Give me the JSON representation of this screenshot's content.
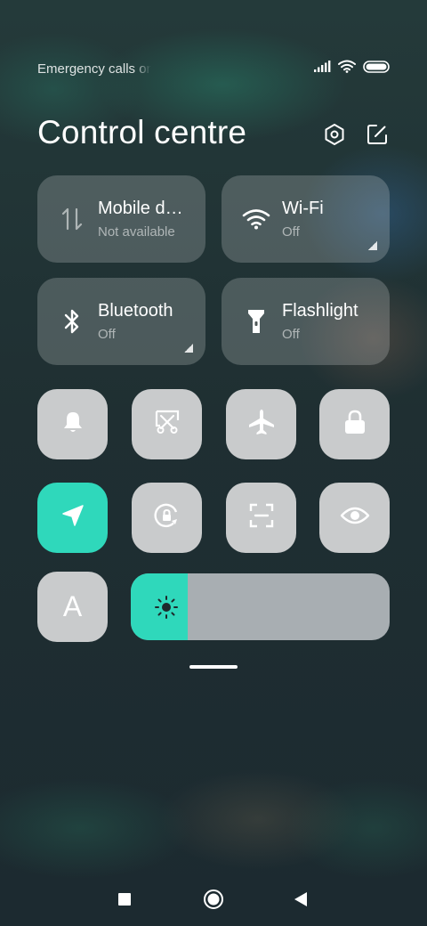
{
  "status_bar": {
    "text": "Emergency calls only",
    "icons": [
      "signal-icon",
      "wifi-icon",
      "battery-icon"
    ]
  },
  "header": {
    "title": "Control centre",
    "actions": [
      "settings-icon",
      "edit-icon"
    ]
  },
  "tiles": [
    {
      "label": "Mobile data",
      "sub": "Not available",
      "icon": "mobile-data-icon"
    },
    {
      "label": "Wi-Fi",
      "sub": "Off",
      "icon": "wifi-icon"
    },
    {
      "label": "Bluetooth",
      "sub": "Off",
      "icon": "bluetooth-icon"
    },
    {
      "label": "Flashlight",
      "sub": "Off",
      "icon": "flashlight-icon"
    }
  ],
  "toggles": [
    {
      "icon": "bell-icon",
      "active": false
    },
    {
      "icon": "screenshot-icon",
      "active": false
    },
    {
      "icon": "airplane-icon",
      "active": false
    },
    {
      "icon": "lock-icon",
      "active": false
    },
    {
      "icon": "location-icon",
      "active": true
    },
    {
      "icon": "rotation-lock-icon",
      "active": false
    },
    {
      "icon": "scan-icon",
      "active": false
    },
    {
      "icon": "eye-icon",
      "active": false
    },
    {
      "icon": "font-size-icon",
      "active": false,
      "glyph": "A"
    }
  ],
  "brightness": {
    "level": 0.22,
    "icon": "sun-icon"
  },
  "colors": {
    "accent": "#2fd8bb",
    "tile_inactive": "#c9cbcc",
    "slider_track": "#a8aeb2"
  },
  "nav_bar": {
    "icons": [
      "recent-apps-icon",
      "home-icon",
      "back-icon"
    ]
  }
}
